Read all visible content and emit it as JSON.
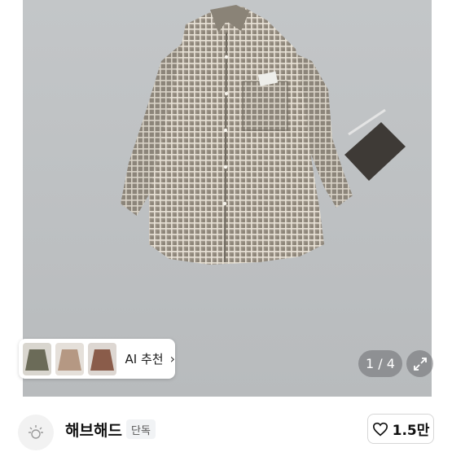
{
  "product_image": {
    "alt_icon": "checked-shirt-photo"
  },
  "ai_recommend": {
    "label": "AI 추천",
    "arrow": "›",
    "thumbnails": [
      {
        "icon": "olive-shirt-thumbnail",
        "color": "#6b6b58"
      },
      {
        "icon": "beige-check-shirt-thumbnail",
        "color": "#b59883"
      },
      {
        "icon": "brown-shirt-thumbnail",
        "color": "#8a5c4a"
      }
    ]
  },
  "gallery": {
    "counter": "1 / 4",
    "expand_icon": "expand-arrows-icon"
  },
  "shop": {
    "name": "해브해드",
    "badge": "단독",
    "avatar_icon": "shop-logo-icon",
    "like_count": "1.5만",
    "like_icon": "heart-outline-icon"
  }
}
